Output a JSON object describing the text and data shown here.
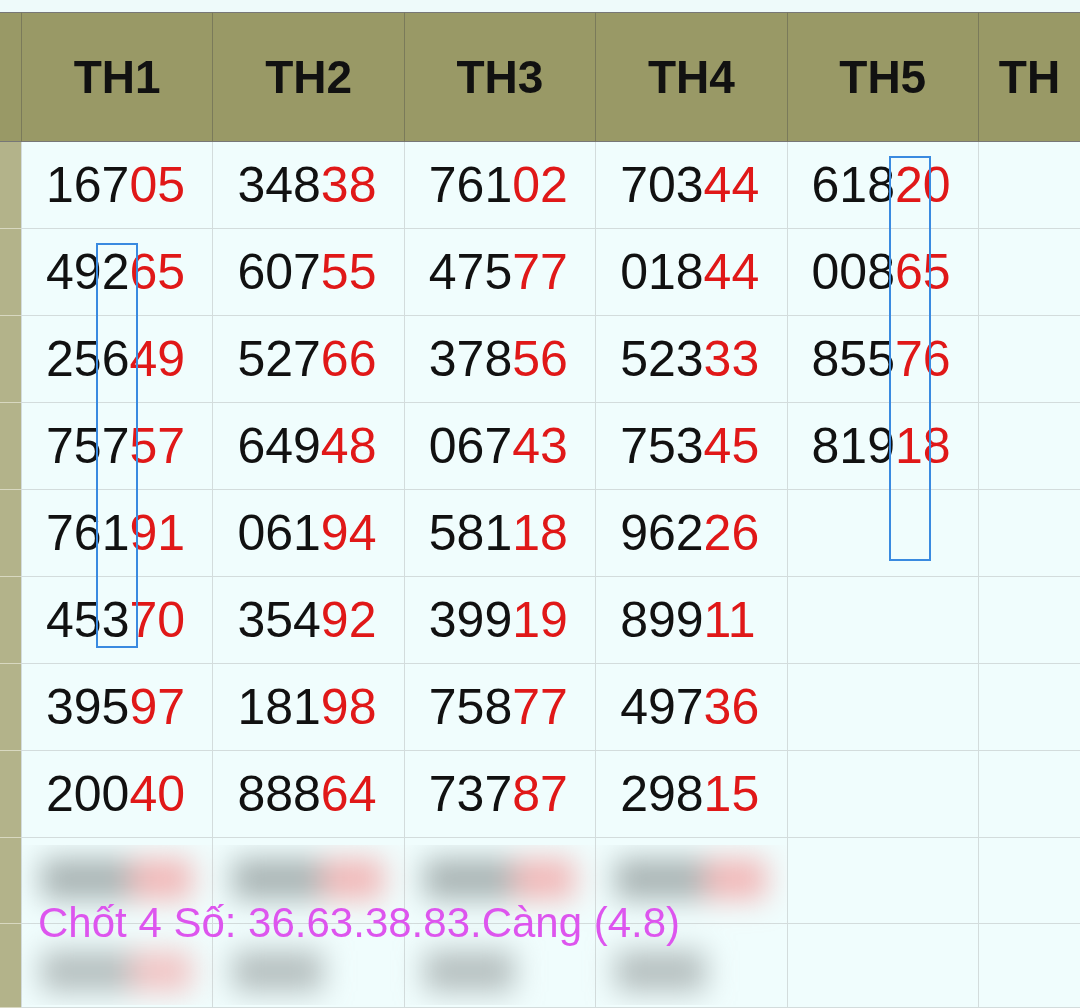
{
  "columns": [
    "TH1",
    "TH2",
    "TH3",
    "TH4",
    "TH5",
    "TH"
  ],
  "rows": [
    [
      {
        "head": "167",
        "tail": "05",
        "boxed": false
      },
      {
        "head": "348",
        "tail": "38",
        "boxed": false
      },
      {
        "head": "761",
        "tail": "02",
        "boxed": false
      },
      {
        "head": "703",
        "tail": "44",
        "boxed": false
      },
      {
        "parts": [
          {
            "text": "618",
            "red": false
          },
          {
            "text": "2",
            "red": true,
            "boxed": true
          },
          {
            "text": "0",
            "red": true
          }
        ],
        "boxed": true
      }
    ],
    [
      {
        "parts": [
          {
            "text": "49",
            "red": false
          },
          {
            "text": "2",
            "red": false,
            "boxed": true
          },
          {
            "text": "65",
            "red": true
          }
        ],
        "boxed": true
      },
      {
        "head": "607",
        "tail": "55",
        "boxed": false
      },
      {
        "head": "475",
        "tail": "77",
        "boxed": false
      },
      {
        "head": "018",
        "tail": "44",
        "boxed": false
      },
      {
        "parts": [
          {
            "text": "008",
            "red": false
          },
          {
            "text": "6",
            "red": true,
            "boxed": true
          },
          {
            "text": "5",
            "red": true
          }
        ],
        "boxed": true
      }
    ],
    [
      {
        "parts": [
          {
            "text": "25",
            "red": false
          },
          {
            "text": "6",
            "red": false,
            "boxed": true
          },
          {
            "text": "49",
            "red": true
          }
        ],
        "boxed": true
      },
      {
        "head": "527",
        "tail": "66",
        "boxed": false
      },
      {
        "head": "378",
        "tail": "56",
        "boxed": false
      },
      {
        "head": "523",
        "tail": "33",
        "boxed": false
      },
      {
        "parts": [
          {
            "text": "855",
            "red": false
          },
          {
            "text": "7",
            "red": true,
            "boxed": true
          },
          {
            "text": "6",
            "red": true
          }
        ],
        "boxed": true
      }
    ],
    [
      {
        "parts": [
          {
            "text": "75",
            "red": false
          },
          {
            "text": "7",
            "red": false,
            "boxed": true
          },
          {
            "text": "57",
            "red": true
          }
        ],
        "boxed": true
      },
      {
        "head": "649",
        "tail": "48",
        "boxed": false
      },
      {
        "head": "067",
        "tail": "43",
        "boxed": false
      },
      {
        "head": "753",
        "tail": "45",
        "boxed": false
      },
      {
        "parts": [
          {
            "text": "819",
            "red": false
          },
          {
            "text": "1",
            "red": true,
            "boxed": true
          },
          {
            "text": "8",
            "red": true
          }
        ],
        "boxed": true
      }
    ],
    [
      {
        "parts": [
          {
            "text": "76",
            "red": false
          },
          {
            "text": "1",
            "red": false,
            "boxed": true
          },
          {
            "text": "91",
            "red": true
          }
        ],
        "boxed": true
      },
      {
        "head": "061",
        "tail": "94",
        "boxed": false
      },
      {
        "head": "581",
        "tail": "18",
        "boxed": false
      },
      {
        "head": "962",
        "tail": "26",
        "boxed": false
      },
      {
        "boxed": true
      }
    ],
    [
      {
        "parts": [
          {
            "text": "45",
            "red": false
          },
          {
            "text": "3",
            "red": false,
            "boxed": true
          },
          {
            "text": "70",
            "red": true
          }
        ],
        "boxed": true
      },
      {
        "head": "354",
        "tail": "92",
        "boxed": false
      },
      {
        "head": "399",
        "tail": "19",
        "boxed": false
      },
      {
        "head": "899",
        "tail": "11",
        "boxed": false
      },
      {
        "boxed": false
      }
    ],
    [
      {
        "head": "395",
        "tail": "97",
        "boxed": false
      },
      {
        "head": "181",
        "tail": "98",
        "boxed": false
      },
      {
        "head": "758",
        "tail": "77",
        "boxed": false
      },
      {
        "head": "497",
        "tail": "36",
        "boxed": false
      },
      {
        "boxed": false
      }
    ],
    [
      {
        "head": "200",
        "tail": "40",
        "boxed": false
      },
      {
        "head": "888",
        "tail": "64",
        "boxed": false
      },
      {
        "head": "737",
        "tail": "87",
        "boxed": false
      },
      {
        "head": "298",
        "tail": "15",
        "boxed": false
      },
      {
        "boxed": false
      }
    ]
  ],
  "note": "Chốt 4 Số: 36.63.38.83.Càng (4.8)"
}
